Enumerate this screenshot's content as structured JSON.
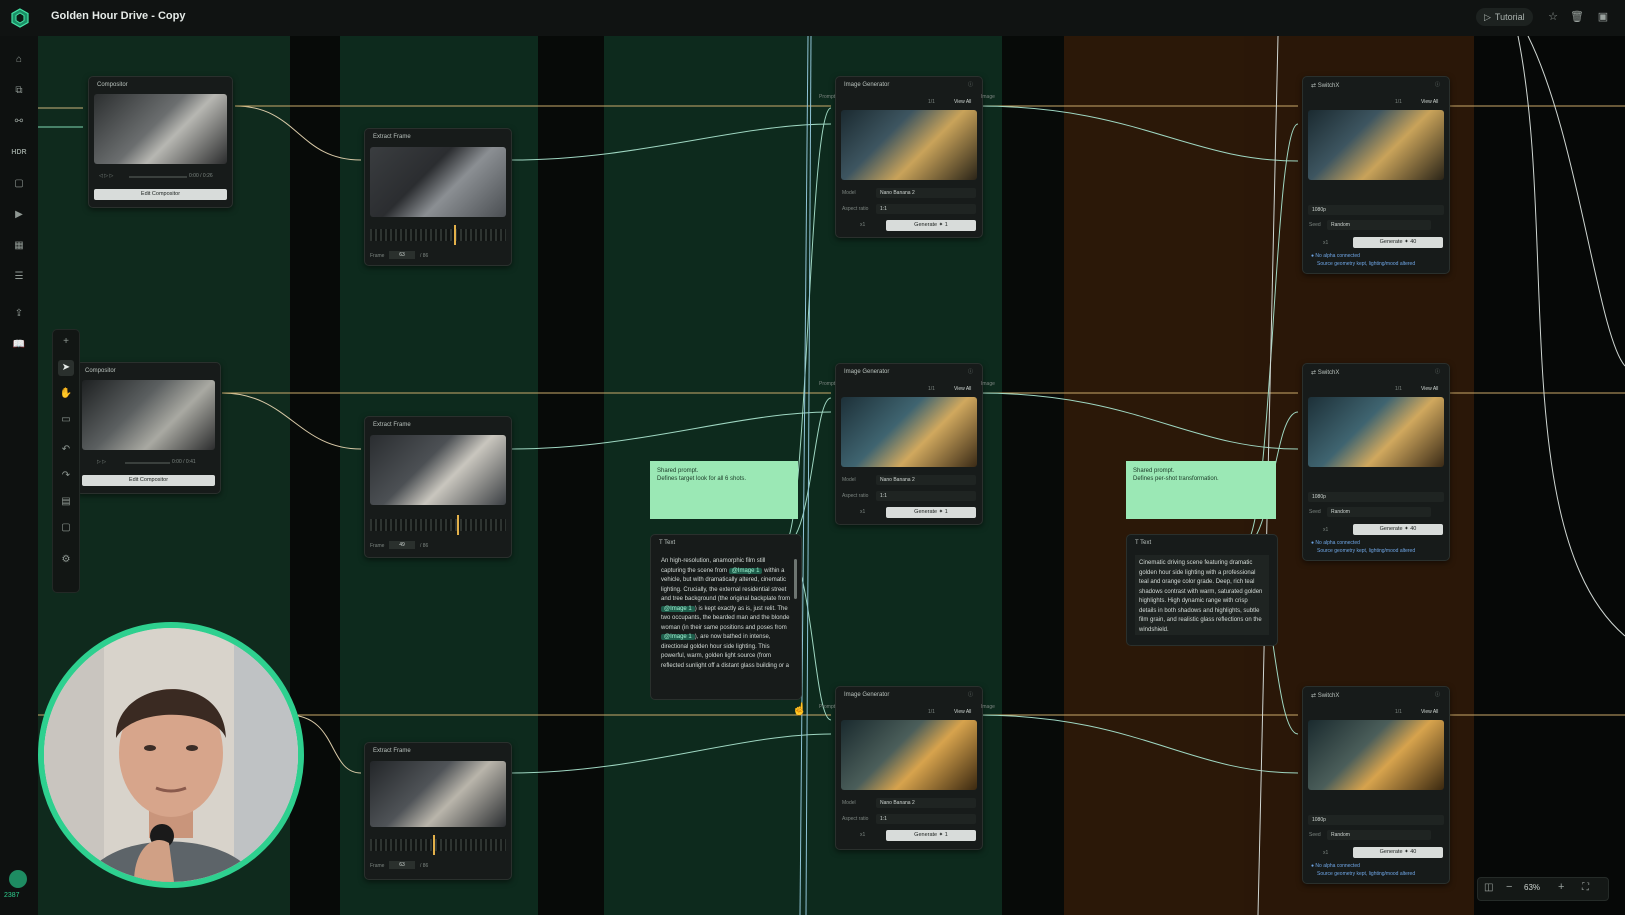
{
  "app": {
    "title": "Golden Hour Drive - Copy",
    "tutorial_label": "Tutorial"
  },
  "colors": {
    "accent": "#2ed08f",
    "note_bg": "#9be8b5",
    "green_col": "#0d2a1d",
    "orange_col": "#2b1708"
  },
  "sidebar": {
    "icons": [
      "home-icon",
      "workflow-icon",
      "nodes-icon",
      "hdr-icon",
      "image-icon",
      "video-icon",
      "gallery-icon",
      "list-icon",
      "export-icon",
      "book-icon"
    ],
    "hdr_label": "HDR",
    "user_count": "2387"
  },
  "nodes": {
    "compositor_title": "Compositor",
    "compositor_time": "0:00 / 0:26",
    "compositor2_time": "0:00 / 0:41",
    "edit_compositor": "Edit Compositor",
    "extract_frame_title": "Extract Frame",
    "frame_label": "Frame",
    "frame_values": [
      "63",
      "49",
      "63"
    ],
    "frame_suffix": "/ 86",
    "image_generator_title": "Image Generator",
    "page_count": "1/1",
    "view_all": "View All",
    "model_label": "Model",
    "model_value": "Nano Banana 2",
    "aspect_label": "Aspect ratio",
    "aspect_value": "1:1",
    "count": "x1",
    "generate_label": "Generate ✦ 1",
    "switchx_title": "SwitchX",
    "res_value": "1080p",
    "seed_label": "Seed",
    "seed_value": "Random",
    "switch_generate": "Generate ✦ 40",
    "alpha_line1": "● No alpha connected",
    "alpha_line2": "Source geometry kept, lighting/mood altered",
    "prompt_label": "Prompt",
    "image_label": "Image",
    "text_title": "Text"
  },
  "notes": {
    "shared_prompt_1": "Shared prompt.\nDefines target look for all 6 shots.",
    "shared_prompt_2": "Shared prompt.\nDefines per-shot transformation."
  },
  "text1": {
    "p1": "An high-resolution, anamorphic film still capturing the scene from ",
    "tag1": "@Image 1",
    "p2": " within a vehicle, but with dramatically altered, cinematic lighting. Crucially, the external residential street and tree background (the original backplate from ",
    "tag2": "@Image 1",
    "p3": ") is kept exactly as is, just relit. The two occupants, the bearded man and the blonde woman (in their same positions and poses from ",
    "tag3": "@Image 1",
    "p4": "), are now bathed in intense, directional golden hour side lighting. This powerful, warm, golden light source (from reflected sunlight off a distant glass building or a"
  },
  "text2": {
    "body": "Cinematic driving scene featuring dramatic golden hour side lighting with a professional teal and orange color grade. Deep, rich teal shadows contrast with warm, saturated golden highlights. High dynamic range with crisp details in both shadows and highlights, subtle film grain, and realistic glass reflections on the windshield."
  },
  "zoom": {
    "level": "63%"
  }
}
